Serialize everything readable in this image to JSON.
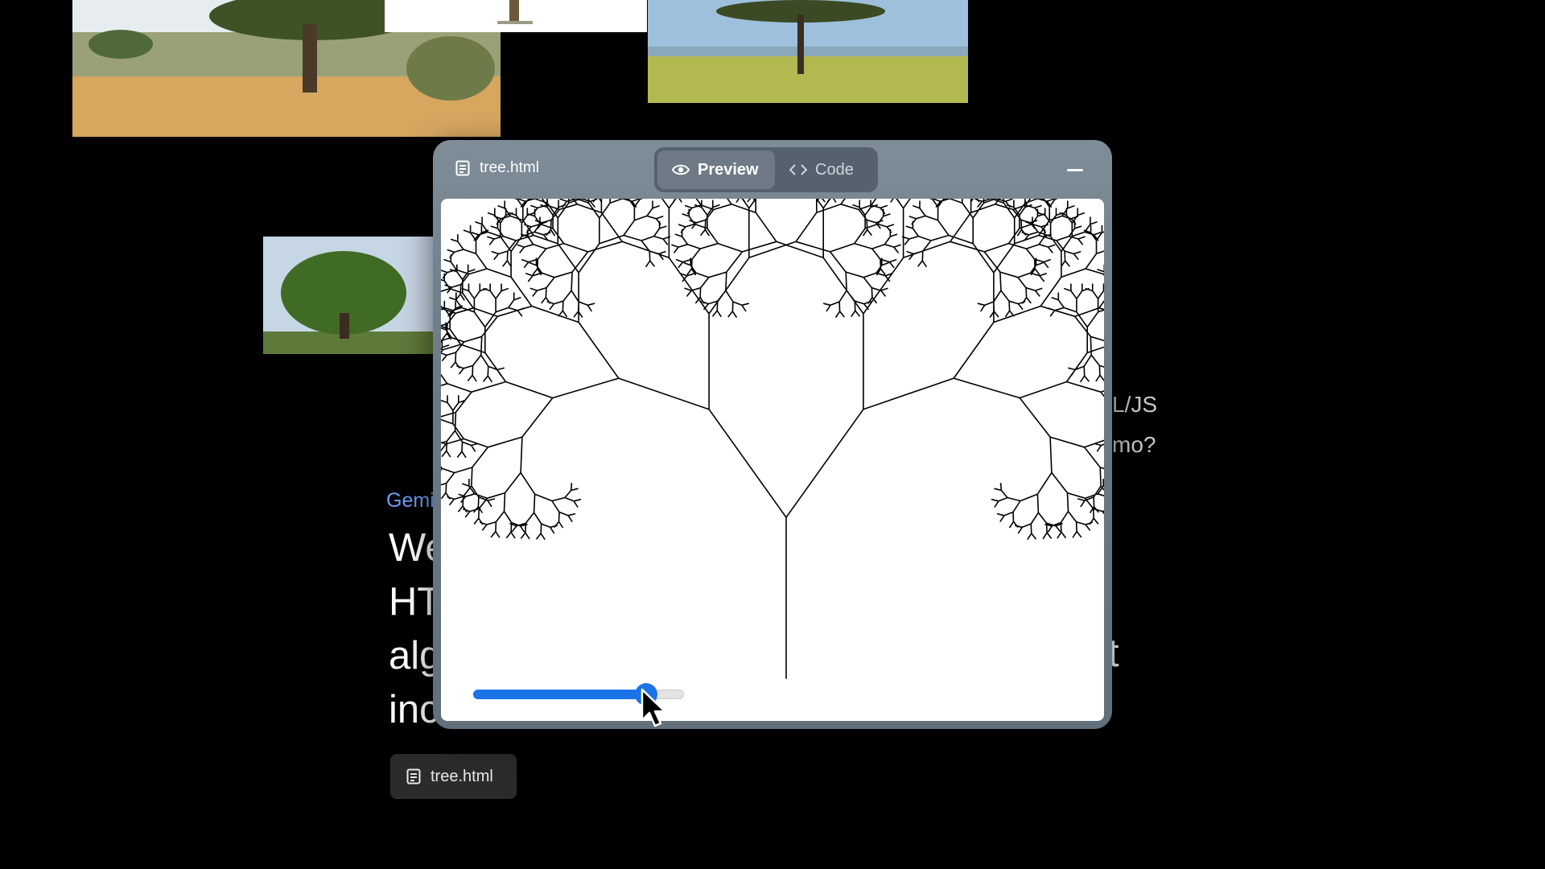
{
  "window": {
    "file_name": "tree.html",
    "tabs": [
      {
        "label": "Preview",
        "icon": "eye-icon",
        "active": true
      },
      {
        "label": "Code",
        "icon": "code-icon",
        "active": false
      }
    ],
    "slider": {
      "value_fraction": 0.82,
      "color": "#1a73e8"
    }
  },
  "chat": {
    "prompt_tail_lines": [
      "L/JS",
      "mo?"
    ],
    "model_label": "Gemi",
    "response_lines": [
      "We",
      "HT",
      "alg",
      "inc"
    ],
    "response_line_tail": "t",
    "attachment": {
      "label": "tree.html",
      "icon": "document-icon"
    }
  }
}
